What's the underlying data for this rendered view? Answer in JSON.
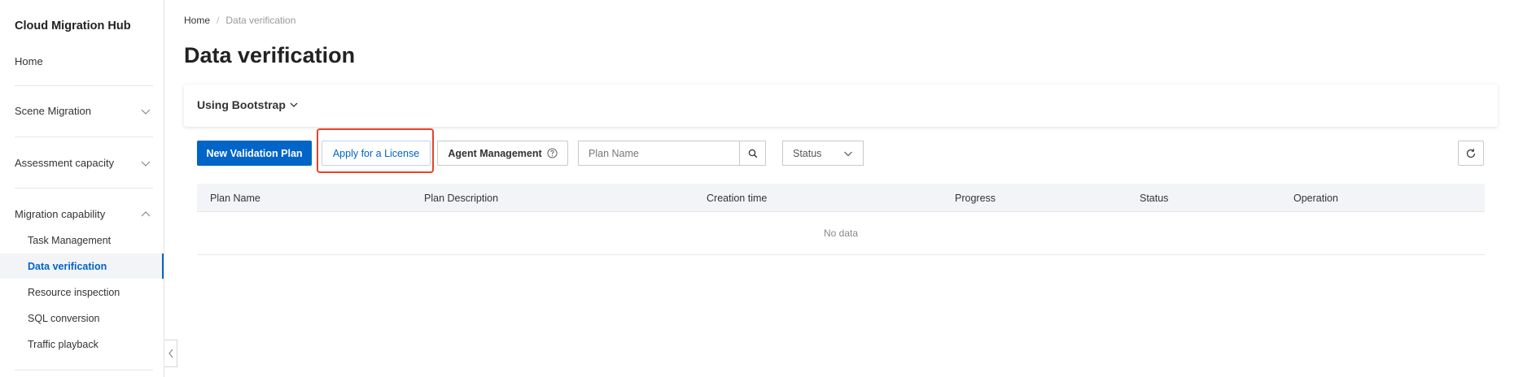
{
  "sidebar": {
    "title": "Cloud Migration Hub",
    "home": "Home",
    "sections": [
      {
        "label": "Scene Migration",
        "expanded": false
      },
      {
        "label": "Assessment capacity",
        "expanded": false
      },
      {
        "label": "Migration capability",
        "expanded": true
      }
    ],
    "sub_items": [
      {
        "label": "Task Management",
        "active": false
      },
      {
        "label": "Data verification",
        "active": true
      },
      {
        "label": "Resource inspection",
        "active": false
      },
      {
        "label": "SQL conversion",
        "active": false
      },
      {
        "label": "Traffic playback",
        "active": false
      }
    ]
  },
  "breadcrumb": {
    "home": "Home",
    "separator": "/",
    "current": "Data verification"
  },
  "page_title": "Data verification",
  "card": {
    "label": "Using Bootstrap"
  },
  "toolbar": {
    "new_plan": "New Validation Plan",
    "apply_license": "Apply for a License",
    "agent_management": "Agent Management",
    "search_placeholder": "Plan Name",
    "status_select": "Status"
  },
  "table": {
    "columns": [
      "Plan Name",
      "Plan Description",
      "Creation time",
      "Progress",
      "Status",
      "Operation"
    ],
    "empty_text": "No data"
  },
  "colors": {
    "primary": "#0064c8",
    "highlight": "#e8422b"
  }
}
